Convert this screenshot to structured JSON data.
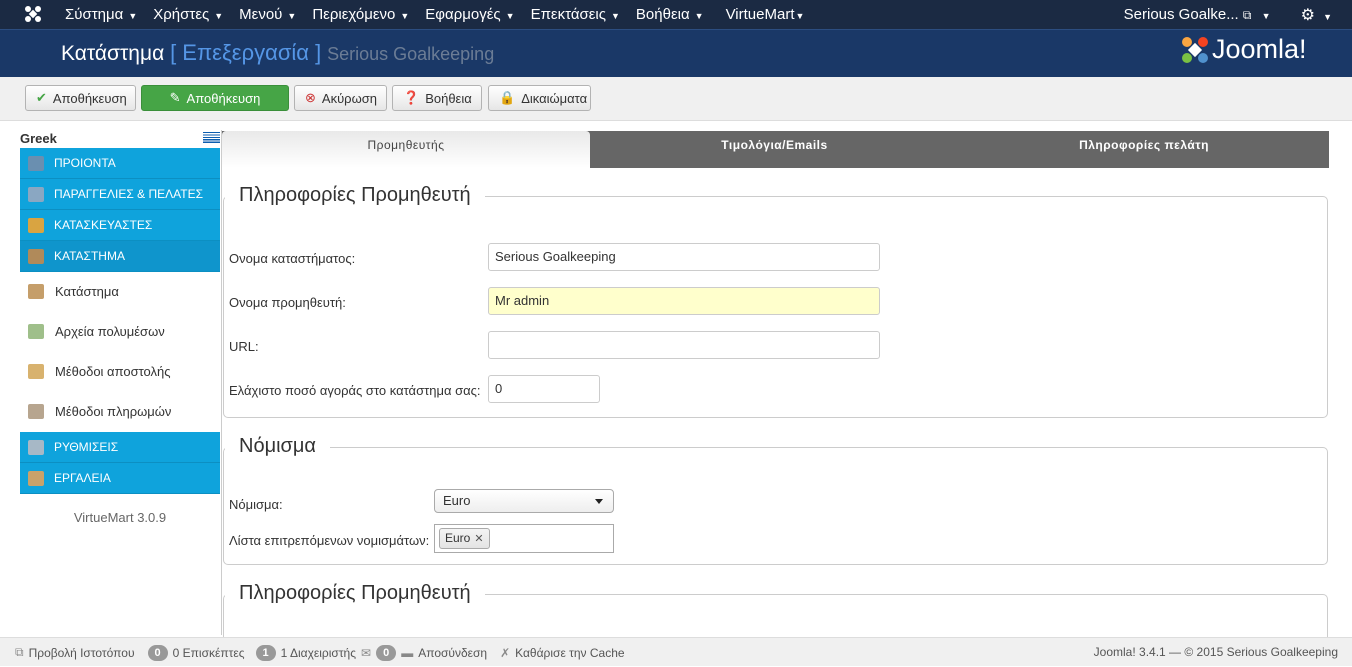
{
  "nav": {
    "menu": [
      "Σύστημα",
      "Χρήστες",
      "Μενού",
      "Περιεχόμενο",
      "Εφαρμογές",
      "Επεκτάσεις",
      "Βοήθεια",
      "VirtueMart"
    ],
    "user": "Serious Goalke...",
    "settings_icon": "gear-icon"
  },
  "header": {
    "title": "Κατάστημα",
    "bracket": "[ Επεξεργασία ]",
    "subtitle": "Serious Goalkeeping",
    "brand": "Joomla!"
  },
  "toolbar": {
    "save": "Αποθήκευση",
    "save_edit": "Αποθήκευση",
    "cancel": "Ακύρωση",
    "help": "Βοήθεια",
    "permissions": "Δικαιώματα"
  },
  "sidebar": {
    "language": "Greek",
    "categories": [
      {
        "label": "ΠΡΟΙΟΝΤΑ",
        "icon": "products-icon"
      },
      {
        "label": "ΠΑΡΑΓΓΕΛΙΕΣ & ΠΕΛΑΤΕΣ",
        "icon": "orders-icon"
      },
      {
        "label": "ΚΑΤΑΣΚΕΥΑΣΤΕΣ",
        "icon": "wrench-icon"
      },
      {
        "label": "ΚΑΤΑΣΤΗΜΑ",
        "icon": "shop-icon"
      }
    ],
    "shop_items": [
      "Κατάστημα",
      "Αρχεία πολυμέσων",
      "Μέθοδοι αποστολής",
      "Μέθοδοι πληρωμών"
    ],
    "bottom_categories": [
      "ΡΥΘΜΙΣΕΙΣ",
      "ΕΡΓΑΛΕΙΑ"
    ],
    "version": "VirtueMart 3.0.9"
  },
  "tabs": [
    "Προμηθευτής",
    "Τιμολόγια/Emails",
    "Πληροφορίες πελάτη"
  ],
  "vendor": {
    "legend": "Πληροφορίες Προμηθευτή",
    "shop_name_label": "Ονομα καταστήματος:",
    "shop_name_value": "Serious Goalkeeping",
    "vendor_name_label": "Ονομα προμηθευτή:",
    "vendor_name_value": "Mr admin",
    "url_label": "URL:",
    "url_value": "",
    "min_label": "Ελάχιστο ποσό αγοράς στο κατάστημα σας:",
    "min_value": "0"
  },
  "currency": {
    "legend": "Νόμισμα",
    "currency_label": "Νόμισμα:",
    "currency_value": "Euro",
    "allowed_label": "Λίστα επιτρεπόμενων νομισμάτων:",
    "allowed_chip": "Euro"
  },
  "vendor2": {
    "legend": "Πληροφορίες Προμηθευτή"
  },
  "footer": {
    "view_site": "Προβολή Ιστοτόπου",
    "visitors_count": "0",
    "visitors": "0 Επισκέπτες",
    "admins_count": "1",
    "admins": "1 Διαχειριστής",
    "messages_count": "0",
    "logout": "Αποσύνδεση",
    "clear_cache": "Καθάρισε την Cache",
    "copyright": "Joomla! 3.4.1  —  © 2015 Serious Goalkeeping"
  }
}
